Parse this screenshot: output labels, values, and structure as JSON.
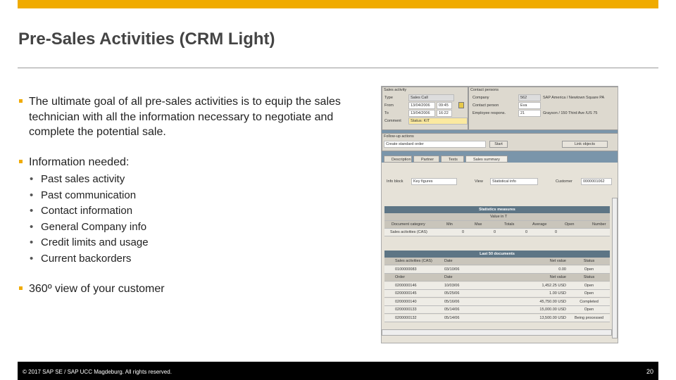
{
  "title": "Pre-Sales Activities (CRM Light)",
  "bullets": {
    "goal": "The ultimate goal of all pre-sales activities is to equip the sales technician with all the information necessary to negotiate and complete the potential sale.",
    "info": "Information needed:",
    "items": [
      "Past sales activity",
      "Past communication",
      "Contact information",
      "General Company info",
      "Credit limits and usage",
      "Current backorders"
    ],
    "view": "360º view of your customer"
  },
  "footer": {
    "copyright": "© 2017 SAP SE / SAP UCC Magdeburg. All rights reserved.",
    "page": "20"
  },
  "sap": {
    "sales_activity": {
      "title": "Sales activity",
      "type_label": "Type",
      "type": "Sales Call",
      "from_label": "From",
      "from_date": "13/04/2006",
      "from_time": "09:45",
      "to_label": "To",
      "to_date": "13/04/2006",
      "to_time": "16:22",
      "comment_label": "Comment",
      "comment": "Status: KIT"
    },
    "contact": {
      "title": "Contact persons",
      "company_label": "Company",
      "company_id": "562",
      "company": "SAP America / Newtown Square PA",
      "person_label": "Contact person",
      "person": "Eva Rosario",
      "emp_label": "Employee respons.",
      "emp_id": "21",
      "emp": "Grayson / 150 Third Ave /US 75"
    },
    "followup": {
      "title": "Follow-up actions",
      "value": "Create standard order",
      "start": "Start",
      "link": "Link objects"
    },
    "tabs": [
      "Description",
      "Partner",
      "Texts",
      "Sales summary"
    ],
    "info_block_label": "Info block",
    "info_block": "Key figures",
    "view_label": "View",
    "view": "Statistical info",
    "customer_label": "Customer",
    "customer": "0000001062",
    "stats": {
      "title": "Statistics measures",
      "subheader": "Value in T",
      "columns": [
        "Document category",
        "Min",
        "Max",
        "Totals",
        "Average",
        "Open",
        "Number"
      ],
      "row": [
        "Sales activities (CAS)",
        "0",
        "0",
        "0",
        "0",
        "",
        ""
      ]
    },
    "last": {
      "title": "Last 50 documents",
      "cas_header": [
        "Sales activities (CAS)",
        "Date",
        "Net value",
        "Status"
      ],
      "cas_rows": [
        [
          "0100000083",
          "03/10/06",
          "0.00",
          "Open"
        ]
      ],
      "order_header": [
        "Order",
        "Date",
        "Net value",
        "Status"
      ],
      "order_rows": [
        [
          "0200000146",
          "10/03/06",
          "1,452.25 USD",
          "Open"
        ],
        [
          "0200000145",
          "05/25/06",
          "1.00 USD",
          "Open"
        ],
        [
          "0200000140",
          "05/16/06",
          "45,750.00 USD",
          "Completed"
        ],
        [
          "0200000133",
          "05/14/06",
          "15,000.00 USD",
          "Open"
        ],
        [
          "0200000132",
          "05/14/06",
          "13,500.00 USD",
          "Being processed"
        ]
      ]
    }
  }
}
